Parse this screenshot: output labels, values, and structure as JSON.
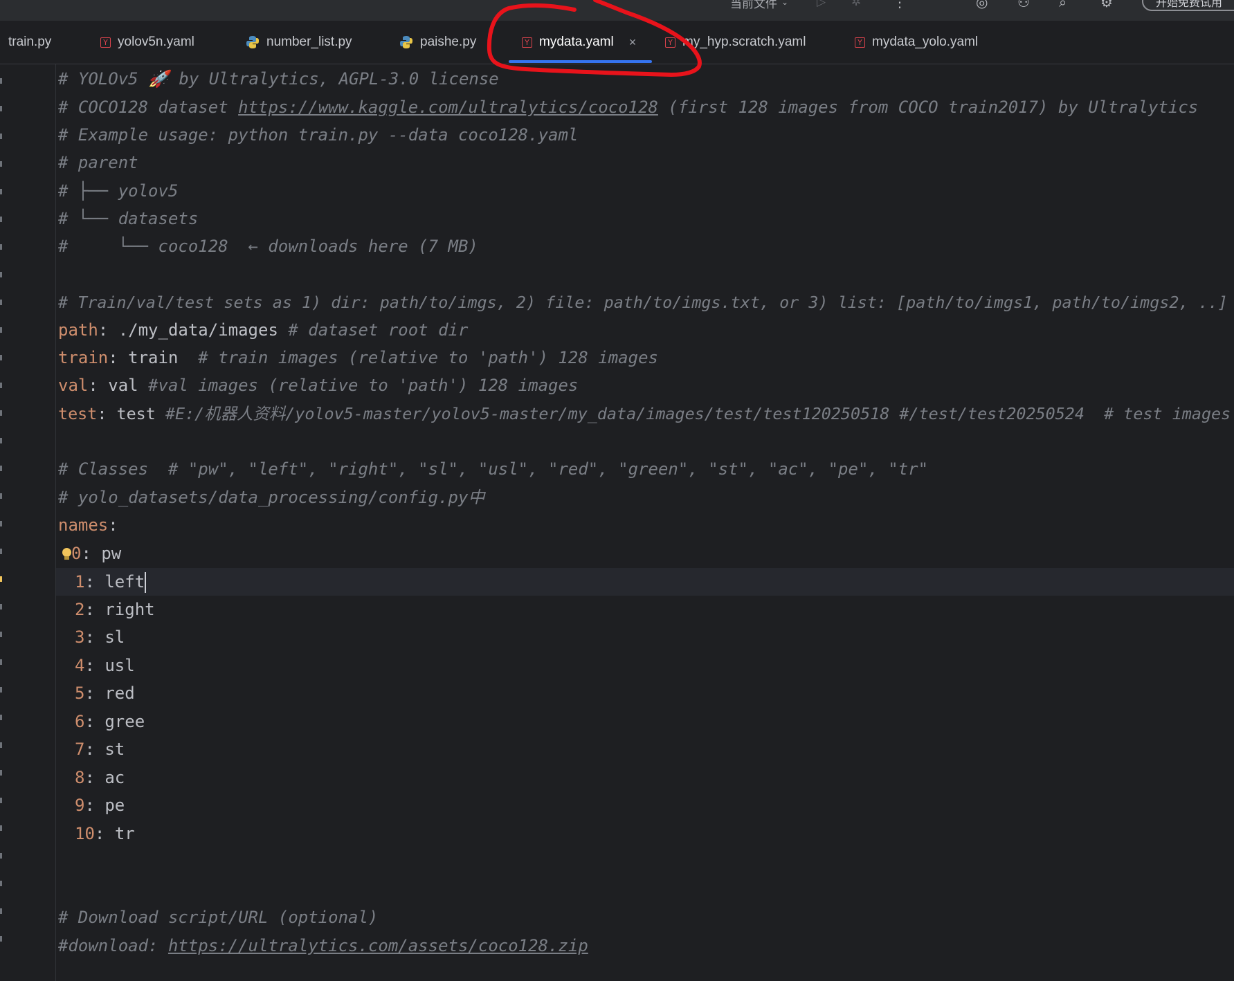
{
  "toolbar": {
    "current_file_label": "当前文件",
    "cta_label": "开始免费试用"
  },
  "tabs": [
    {
      "label": "train.py",
      "icon": "python-icon",
      "active": false
    },
    {
      "label": "yolov5n.yaml",
      "icon": "yaml-icon",
      "active": false
    },
    {
      "label": "number_list.py",
      "icon": "python-icon",
      "active": false
    },
    {
      "label": "paishe.py",
      "icon": "python-icon",
      "active": false
    },
    {
      "label": "mydata.yaml",
      "icon": "yaml-icon",
      "active": true
    },
    {
      "label": "my_hyp.scratch.yaml",
      "icon": "yaml-icon",
      "active": false
    },
    {
      "label": "mydata_yolo.yaml",
      "icon": "yaml-icon",
      "active": false
    }
  ],
  "code": {
    "l1": "# YOLOv5 🚀 by Ultralytics, AGPL-3.0 license",
    "l2_pre": "# COCO128 dataset ",
    "l2_url": "https://www.kaggle.com/ultralytics/coco128",
    "l2_post": " (first 128 images from COCO train2017) by Ultralytics",
    "l3": "# Example usage: python train.py --data coco128.yaml",
    "l4": "# parent",
    "l5": "# ├── yolov5",
    "l6": "# └── datasets",
    "l7": "#     └── coco128  ← downloads here (7 MB)",
    "l9": "# Train/val/test sets as 1) dir: path/to/imgs, 2) file: path/to/imgs.txt, or 3) list: [path/to/imgs1, path/to/imgs2, ..]",
    "path_key": "path",
    "path_val": " ./my_data/images ",
    "path_cmt": "# dataset root dir",
    "train_key": "train",
    "train_val": " train  ",
    "train_cmt": "# train images (relative to 'path') 128 images",
    "val_key": "val",
    "val_val": " val ",
    "val_cmt": "#val images (relative to 'path') 128 images",
    "test_key": "test",
    "test_val": " test ",
    "test_cmt": "#E:/机器人资料/yolov5-master/yolov5-master/my_data/images/test/test120250518 #/test/test20250524  # test images",
    "classes_cmt": "# Classes  # \"pw\", \"left\", \"right\", \"sl\", \"usl\", \"red\", \"green\", \"st\", \"ac\", \"pe\", \"tr\"",
    "config_cmt": "# yolo_datasets/data_processing/config.py中",
    "names_key": "names",
    "names": [
      {
        "idx": "0",
        "name": "pw"
      },
      {
        "idx": "1",
        "name": "left"
      },
      {
        "idx": "2",
        "name": "right"
      },
      {
        "idx": "3",
        "name": "sl"
      },
      {
        "idx": "4",
        "name": "usl"
      },
      {
        "idx": "5",
        "name": "red"
      },
      {
        "idx": "6",
        "name": "gree"
      },
      {
        "idx": "7",
        "name": "st"
      },
      {
        "idx": "8",
        "name": "ac"
      },
      {
        "idx": "9",
        "name": "pe"
      },
      {
        "idx": "10",
        "name": "tr"
      }
    ],
    "download_cmt": "# Download script/URL (optional)",
    "download_pre": "#download: ",
    "download_url": "https://ultralytics.com/assets/coco128.zip"
  },
  "colors": {
    "background": "#1e1f22",
    "comment": "#7a7e85",
    "key": "#cf8e6d",
    "active_tab_underline": "#3574f0",
    "annotation": "#e8131b"
  }
}
